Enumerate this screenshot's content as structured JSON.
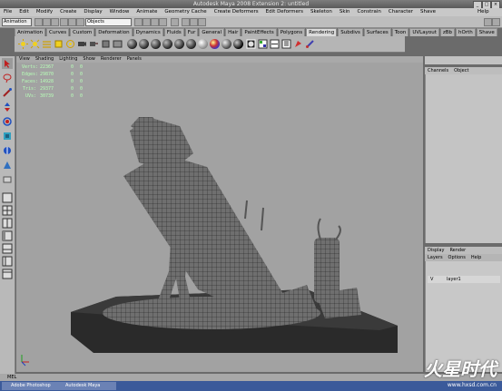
{
  "window": {
    "title": "Autodesk Maya 2008 Extension 2: untitled"
  },
  "menubar": [
    "File",
    "Edit",
    "Modify",
    "Create",
    "Display",
    "Window",
    "Animate",
    "Geometry Cache",
    "Create Deformers",
    "Edit Deformers",
    "Skeleton",
    "Skin",
    "Constrain",
    "Character",
    "Shave",
    "Help"
  ],
  "statusline": {
    "mode": "Animation",
    "object_field": "Objects"
  },
  "shelf": {
    "tabs": [
      "Animation",
      "Curves",
      "Custom",
      "Deformation",
      "Dynamics",
      "Fluids",
      "Fur",
      "General",
      "Hair",
      "PaintEffects",
      "Polygons",
      "Rendering",
      "Subdivs",
      "Surfaces",
      "Toon",
      "UVLayout",
      "zBb",
      "hOrth",
      "Shave"
    ],
    "active_tab": "Rendering"
  },
  "viewport": {
    "menu": [
      "View",
      "Shading",
      "Lighting",
      "Show",
      "Renderer",
      "Panels"
    ],
    "hud": [
      {
        "label": "Verts:",
        "value": "22367",
        "v2": "0",
        "v3": "0"
      },
      {
        "label": "Edges:",
        "value": "29870",
        "v2": "0",
        "v3": "0"
      },
      {
        "label": "Faces:",
        "value": "14928",
        "v2": "0",
        "v3": "0"
      },
      {
        "label": "Tris:",
        "value": "29377",
        "v2": "0",
        "v3": "0"
      },
      {
        "label": "UVs:",
        "value": "30739",
        "v2": "0",
        "v3": "0"
      }
    ]
  },
  "channel_box": {
    "tabs": [
      "Channels",
      "Object"
    ]
  },
  "layer_editor": {
    "tabs": [
      "Display",
      "Render"
    ],
    "menu": [
      "Layers",
      "Options",
      "Help"
    ],
    "layer": {
      "visible": "V",
      "name": "layer1"
    }
  },
  "command_line": {
    "label": "MEL"
  },
  "taskbar": {
    "items": [
      "Adobe Photoshop",
      "Autodesk Maya"
    ]
  },
  "watermark": {
    "text": "火星时代",
    "url": "www.hxsd.com.cn"
  },
  "colors": {
    "viewport_bg": "#a2a2a2",
    "hud_text": "#b8ffb8",
    "mesh_fill": "#6f6f6f",
    "mesh_wire": "#1a1a1a",
    "base": "#2a2a2a"
  }
}
